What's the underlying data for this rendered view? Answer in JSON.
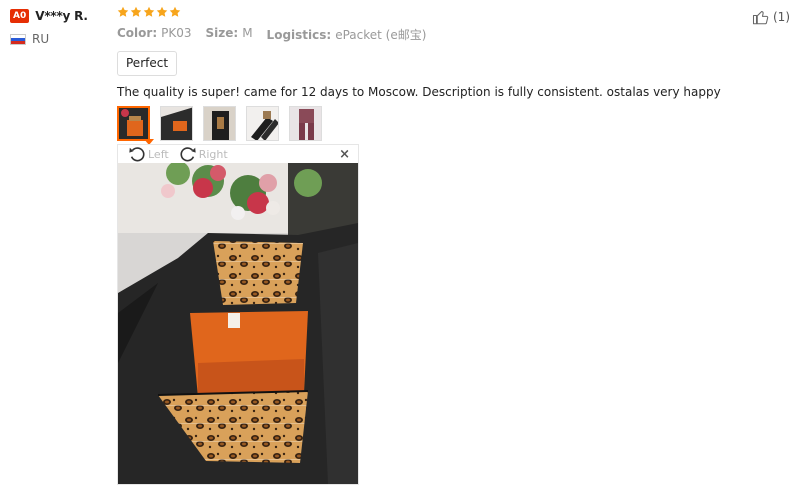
{
  "user": {
    "level_badge": "A0",
    "name": "V***y R.",
    "country": "RU"
  },
  "review": {
    "rating": 5,
    "attributes": [
      {
        "label": "Color:",
        "value": "PK03"
      },
      {
        "label": "Size:",
        "value": "M"
      },
      {
        "label": "Logistics:",
        "value": "ePacket (e邮宝)"
      }
    ],
    "tag": "Perfect",
    "text": "The quality is super! came for 12 days to Moscow. Description is fully consistent. ostalas very happy",
    "helpful_count": "(1)"
  },
  "viewer": {
    "rotate_left_label": "Left",
    "rotate_right_label": "Right",
    "close_label": "×"
  },
  "colors": {
    "badge": "#e62e04",
    "star": "#f7a51c",
    "active_thumb_border": "#ff6600"
  },
  "icons": [
    "star-icon",
    "thumbs-up-icon",
    "rotate-left-icon",
    "rotate-right-icon",
    "close-icon",
    "russia-flag-icon"
  ]
}
